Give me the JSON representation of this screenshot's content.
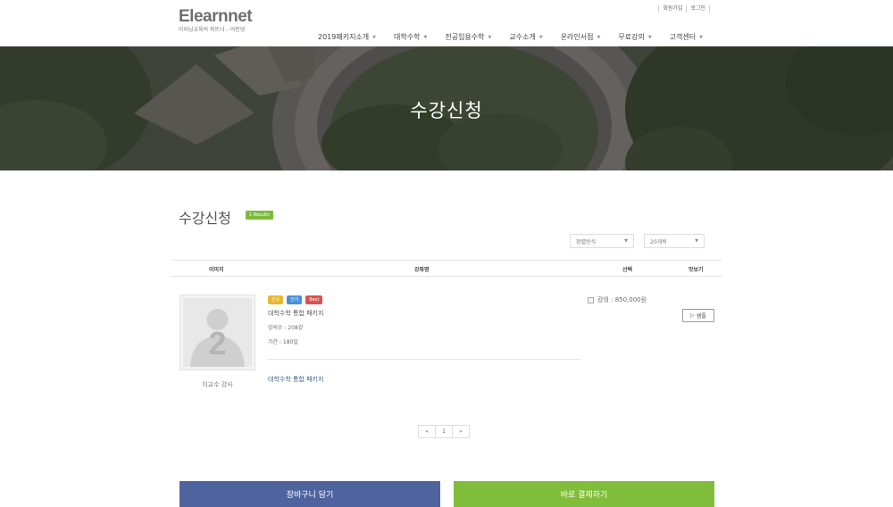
{
  "header": {
    "logo_main": "Elearnnet",
    "logo_sub": "이러닝교육의 파트너 - 이런넷",
    "top_links": [
      "회원가입",
      "로그인"
    ],
    "nav": [
      "2019패키지소개",
      "대학수학",
      "전공임용수학",
      "교수소개",
      "온라인서점",
      "무료강의",
      "고객센터"
    ]
  },
  "hero": {
    "title": "수강신청"
  },
  "content": {
    "heading": "수강신청",
    "results_badge": "1 Results",
    "sort_select": "정렬방식",
    "count_select": "20개씩",
    "columns": {
      "image": "이미지",
      "course": "강좌명",
      "select": "선택",
      "preview": "맛보기"
    }
  },
  "course": {
    "tags": [
      {
        "label": "신규",
        "color": "#e8b830"
      },
      {
        "label": "인기",
        "color": "#4a90d9"
      },
      {
        "label": "Best",
        "color": "#d9534f"
      }
    ],
    "title": "대학수학 통합 패키지",
    "lecture_count": "강의수 : 208강",
    "period": "기간 : 180일",
    "link_text": "대학수학 통합 패키지",
    "instructor": "이교수 강사",
    "thumb_number": "2",
    "price": "강의 : 850,000원",
    "sample_label": "샘플"
  },
  "pagination": {
    "prev": "«",
    "current": "1",
    "next": "»"
  },
  "actions": {
    "cart": "장바구니 담기",
    "pay": "바로 결제하기"
  },
  "colors": {
    "cart": "#4f649e",
    "pay": "#80bd3a",
    "badge": "#7cbb3b"
  }
}
